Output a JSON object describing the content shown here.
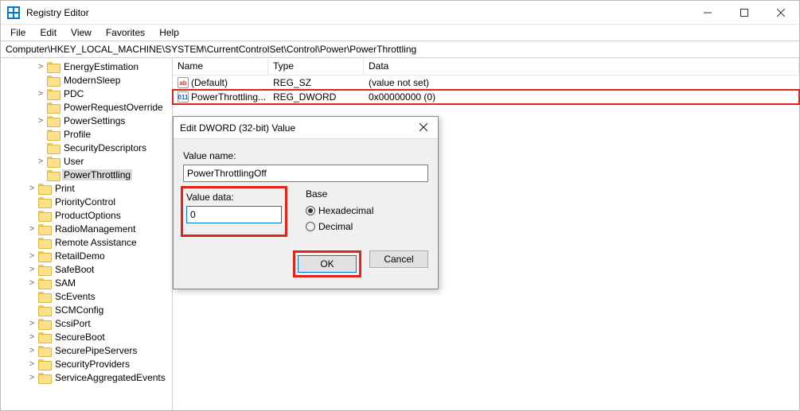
{
  "window": {
    "title": "Registry Editor"
  },
  "menu": {
    "file": "File",
    "edit": "Edit",
    "view": "View",
    "favorites": "Favorites",
    "help": "Help"
  },
  "address": "Computer\\HKEY_LOCAL_MACHINE\\SYSTEM\\CurrentControlSet\\Control\\Power\\PowerThrottling",
  "tree": [
    {
      "label": "EnergyEstimation",
      "depth": 4,
      "exp": ">"
    },
    {
      "label": "ModernSleep",
      "depth": 4,
      "exp": ""
    },
    {
      "label": "PDC",
      "depth": 4,
      "exp": ">"
    },
    {
      "label": "PowerRequestOverride",
      "depth": 4,
      "exp": ""
    },
    {
      "label": "PowerSettings",
      "depth": 4,
      "exp": ">"
    },
    {
      "label": "Profile",
      "depth": 4,
      "exp": ""
    },
    {
      "label": "SecurityDescriptors",
      "depth": 4,
      "exp": ""
    },
    {
      "label": "User",
      "depth": 4,
      "exp": ">"
    },
    {
      "label": "PowerThrottling",
      "depth": 4,
      "exp": "",
      "selected": true
    },
    {
      "label": "Print",
      "depth": 3,
      "exp": ">"
    },
    {
      "label": "PriorityControl",
      "depth": 3,
      "exp": ""
    },
    {
      "label": "ProductOptions",
      "depth": 3,
      "exp": ""
    },
    {
      "label": "RadioManagement",
      "depth": 3,
      "exp": ">"
    },
    {
      "label": "Remote Assistance",
      "depth": 3,
      "exp": ""
    },
    {
      "label": "RetailDemo",
      "depth": 3,
      "exp": ">"
    },
    {
      "label": "SafeBoot",
      "depth": 3,
      "exp": ">"
    },
    {
      "label": "SAM",
      "depth": 3,
      "exp": ">"
    },
    {
      "label": "ScEvents",
      "depth": 3,
      "exp": ""
    },
    {
      "label": "SCMConfig",
      "depth": 3,
      "exp": ""
    },
    {
      "label": "ScsiPort",
      "depth": 3,
      "exp": ">"
    },
    {
      "label": "SecureBoot",
      "depth": 3,
      "exp": ">"
    },
    {
      "label": "SecurePipeServers",
      "depth": 3,
      "exp": ">"
    },
    {
      "label": "SecurityProviders",
      "depth": 3,
      "exp": ">"
    },
    {
      "label": "ServiceAggregatedEvents",
      "depth": 3,
      "exp": ">"
    }
  ],
  "list": {
    "headers": {
      "name": "Name",
      "type": "Type",
      "data": "Data"
    },
    "rows": [
      {
        "icon": "sz",
        "iconText": "ab",
        "name": "(Default)",
        "type": "REG_SZ",
        "data": "(value not set)",
        "selected": false
      },
      {
        "icon": "dw",
        "iconText": "011",
        "name": "PowerThrottling...",
        "type": "REG_DWORD",
        "data": "0x00000000 (0)",
        "selected": true
      }
    ]
  },
  "dialog": {
    "title": "Edit DWORD (32-bit) Value",
    "valueNameLabel": "Value name:",
    "valueName": "PowerThrottlingOff",
    "valueDataLabel": "Value data:",
    "valueData": "0",
    "baseLabel": "Base",
    "hexLabel": "Hexadecimal",
    "decLabel": "Decimal",
    "baseSelected": "hex",
    "ok": "OK",
    "cancel": "Cancel"
  }
}
